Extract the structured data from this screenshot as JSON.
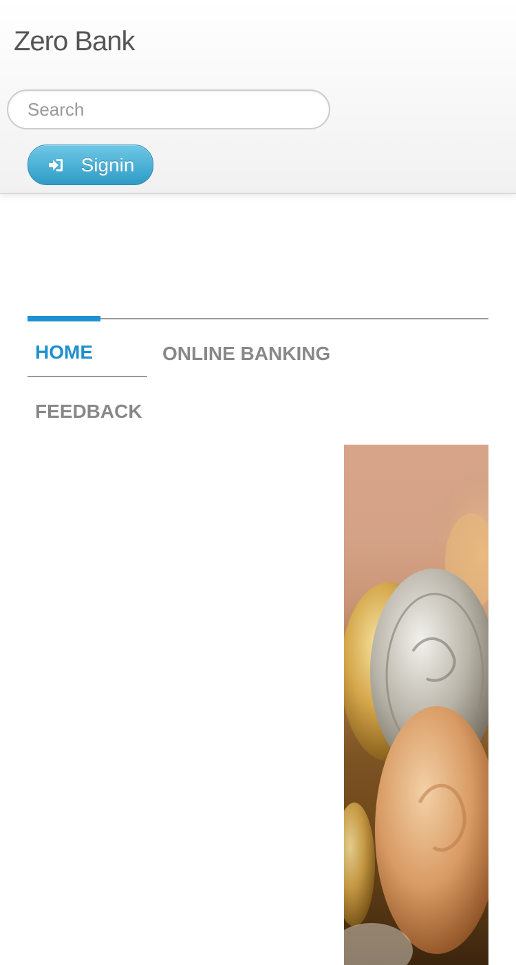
{
  "header": {
    "brand": "Zero Bank",
    "search_placeholder": "Search",
    "signin_label": "Signin"
  },
  "nav": {
    "items": [
      {
        "label": "HOME",
        "active": true
      },
      {
        "label": "ONLINE BANKING",
        "active": false
      },
      {
        "label": "FEEDBACK",
        "active": false
      }
    ]
  },
  "colors": {
    "accent": "#1e90d1",
    "signin_button": "#3aa6d0",
    "nav_inactive": "#888888"
  },
  "icons": {
    "signin": "sign-in-icon"
  }
}
